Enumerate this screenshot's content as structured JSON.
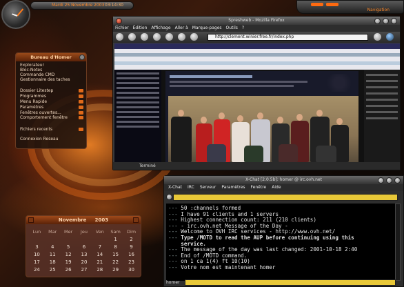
{
  "topbar": {
    "date": "Mardi 25 Novembre 2003",
    "time": "03:14:30"
  },
  "navigation": {
    "label": "Navigation"
  },
  "bureau": {
    "title": "Bureau d'Homer",
    "items": [
      "Explorateur",
      "Bloc-Notes",
      "Commande CMD",
      "Gestionnaire des taches",
      "Dossier Litestep",
      "Programmes",
      "Menu Rapide",
      "Paramètres",
      "Fenêtres ouvertes...",
      "Comportement fenêtre",
      "Fichiers recents",
      "Connexion Reseau"
    ]
  },
  "firefox": {
    "title": "Spreshweb - Mozilla Firefox",
    "menu": [
      "Fichier",
      "Édition",
      "Affichage",
      "Aller à",
      "Marque-pages",
      "Outils",
      "?"
    ],
    "url": "http://clement.winier.free.fr/index.php",
    "status": "Terminé"
  },
  "xchat": {
    "title": "X-Chat [2.0.5b]: homer @ irc.ovh.net",
    "menu": [
      "X-Chat",
      "IRC",
      "Serveur",
      "Paramètres",
      "Fenêtre",
      "Aide"
    ],
    "log": [
      {
        "prefix": "---",
        "text": "50 :channels formed",
        "bold": false
      },
      {
        "prefix": "---",
        "text": "I have 91 clients and 1 servers",
        "bold": false
      },
      {
        "prefix": "---",
        "text": "Highest connection count: 211 (210 clients)",
        "bold": false
      },
      {
        "prefix": "---",
        "text": "- irc.ovh.net Message of the Day -",
        "bold": false
      },
      {
        "prefix": "---",
        "text": "Welcome to OVH IRC services - http://www.ovh.net/",
        "bold": false
      },
      {
        "prefix": "---",
        "text": "Type /MOTD to read the AUP before continuing using this",
        "bold": true
      },
      {
        "prefix": "",
        "text": "service.",
        "bold": true
      },
      {
        "prefix": "---",
        "text": "The message of the day was last changed: 2001-10-18 2:40",
        "bold": false
      },
      {
        "prefix": "---",
        "text": "End of /MOTD command.",
        "bold": false
      },
      {
        "prefix": "---",
        "text": "on 1 ca 1(4) ft 10(10)",
        "bold": false
      },
      {
        "prefix": "---",
        "text": "Votre nom est maintenant homer",
        "bold": false
      }
    ],
    "nick": "homer"
  },
  "calendar": {
    "month": "Novembre",
    "year": "2003",
    "weekdays": [
      "Lun",
      "Mar",
      "Mer",
      "Jeu",
      "Ven",
      "Sam",
      "Dim"
    ],
    "weeks": [
      [
        "",
        "",
        "",
        "",
        "",
        "1",
        "2"
      ],
      [
        "3",
        "4",
        "5",
        "6",
        "7",
        "8",
        "9"
      ],
      [
        "10",
        "11",
        "12",
        "13",
        "14",
        "15",
        "16"
      ],
      [
        "17",
        "18",
        "19",
        "20",
        "21",
        "22",
        "23"
      ],
      [
        "24",
        "25",
        "26",
        "27",
        "28",
        "29",
        "30"
      ]
    ]
  },
  "colors": {
    "accent": "#ff7a1a",
    "topic_bar": "#e8c838"
  }
}
